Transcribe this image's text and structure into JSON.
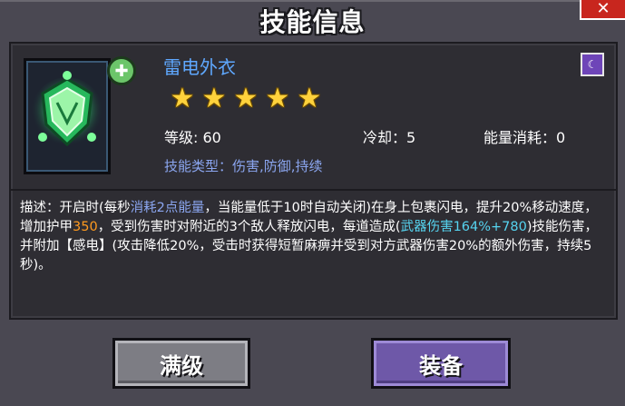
{
  "window": {
    "title": "技能信息",
    "close_icon": "close-icon"
  },
  "skill": {
    "name": "雷电外衣",
    "icon": "shield-lightning-icon",
    "badge_icon": "plus-badge-icon",
    "type_icon": "skill-type-icon",
    "stars": 5,
    "level_text": "等级: 60",
    "cooldown_text": "冷却：5",
    "energy_text": "能量消耗：0",
    "type_text": "技能类型：伤害,防御,持续"
  },
  "description": {
    "p1": "描述：开启时(每秒",
    "p2": "消耗2点能量",
    "p3": "，当能量低于10时自动关闭)在身上包裹闪电，提升20%移动速度，增加护甲",
    "p4": "350",
    "p5": "，受到伤害时对附近的3个敌人释放闪电，每道造成(",
    "p6": "武器伤害164%+780",
    "p7": ")技能伤害，并附加【感电】(攻击降低20%，受击时获得短暂麻痹并受到对方武器伤害20%的额外伤害，持续5秒)。"
  },
  "buttons": {
    "max_label": "满级",
    "equip_label": "装备"
  },
  "colors": {
    "panel": "#4a4852",
    "frame": "#2e2d33",
    "name_blue": "#5fa8ff",
    "type_blue": "#8ba6f0",
    "armor_orange": "#ff9a1f",
    "damage_cyan": "#56d4f0",
    "equip_purple": "#6e58a8",
    "max_gray": "#7d7d84",
    "close_red": "#c8261e"
  }
}
